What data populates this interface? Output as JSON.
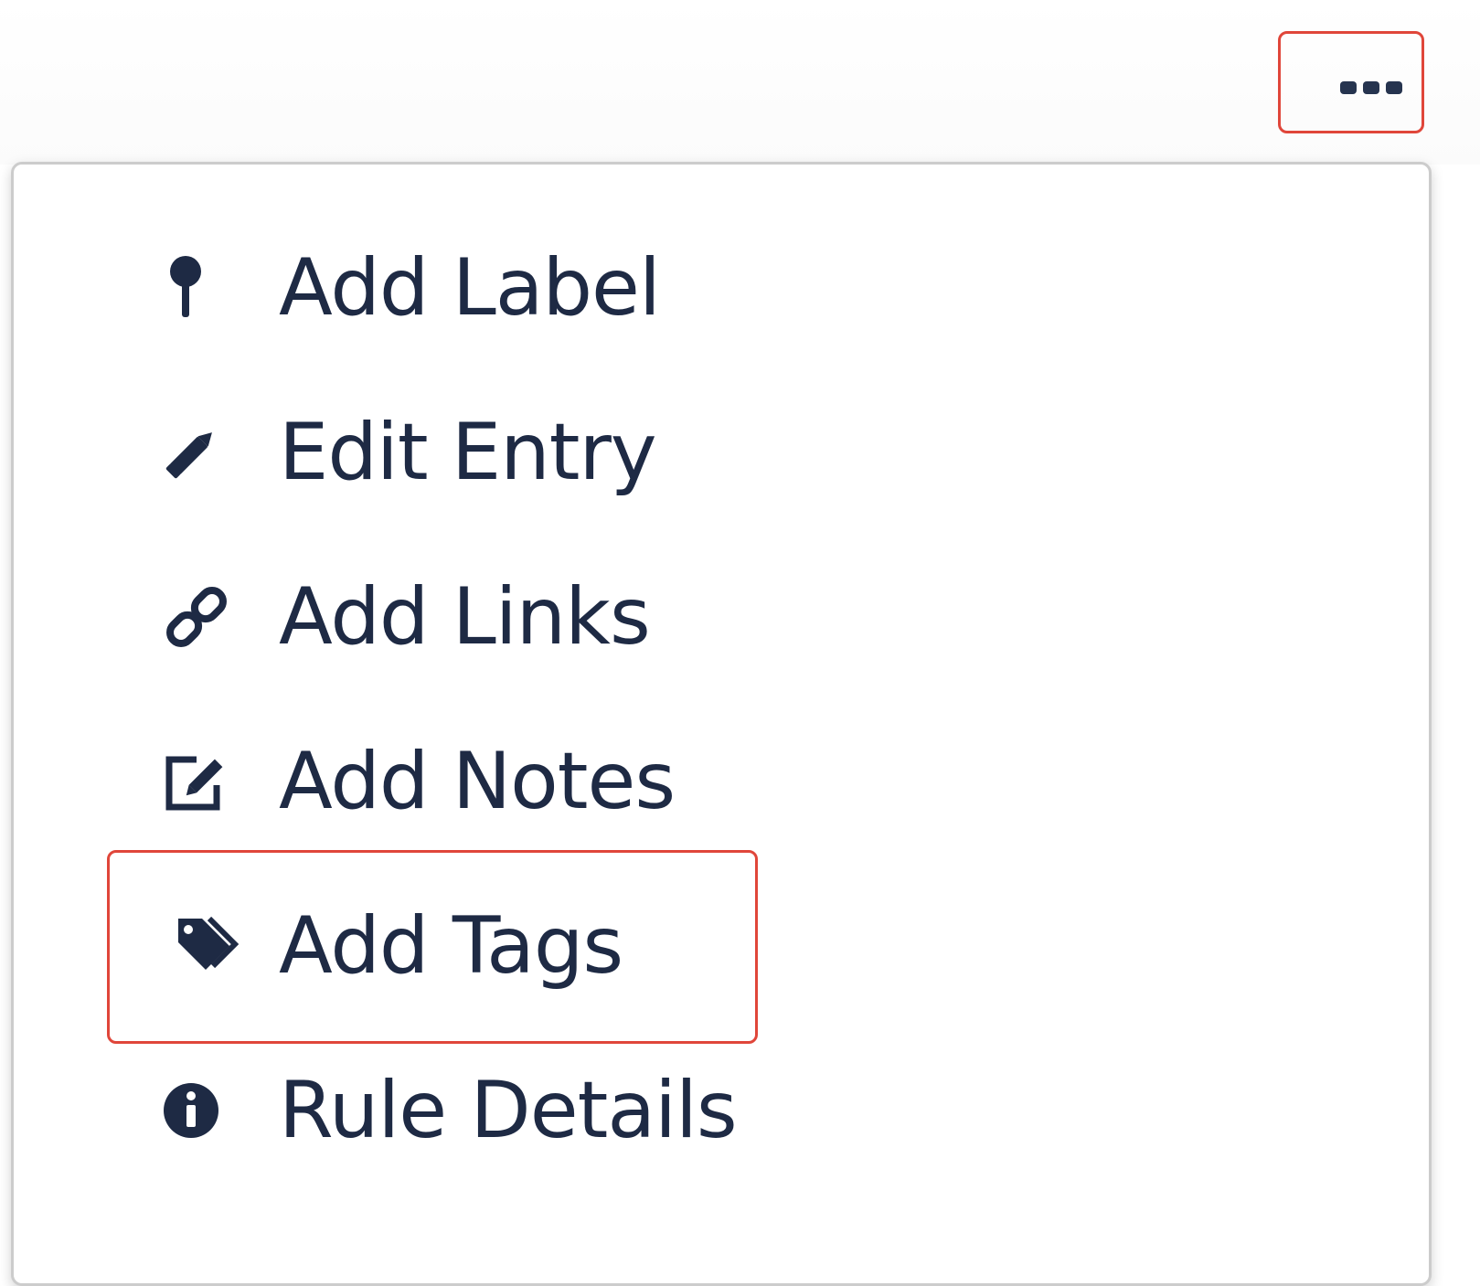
{
  "toolbar": {
    "more_icon": "ellipsis-icon"
  },
  "menu": {
    "items": [
      {
        "label": "Add Label",
        "icon": "pushpin-icon"
      },
      {
        "label": "Edit Entry",
        "icon": "pencil-icon"
      },
      {
        "label": "Add Links",
        "icon": "link-icon"
      },
      {
        "label": "Add Notes",
        "icon": "edit-note-icon"
      },
      {
        "label": "Add Tags",
        "icon": "tags-icon"
      },
      {
        "label": "Rule Details",
        "icon": "info-circle-icon"
      }
    ]
  },
  "colors": {
    "highlight": "#e0463a",
    "text": "#1e2a44",
    "icon": "#1e2a44"
  }
}
